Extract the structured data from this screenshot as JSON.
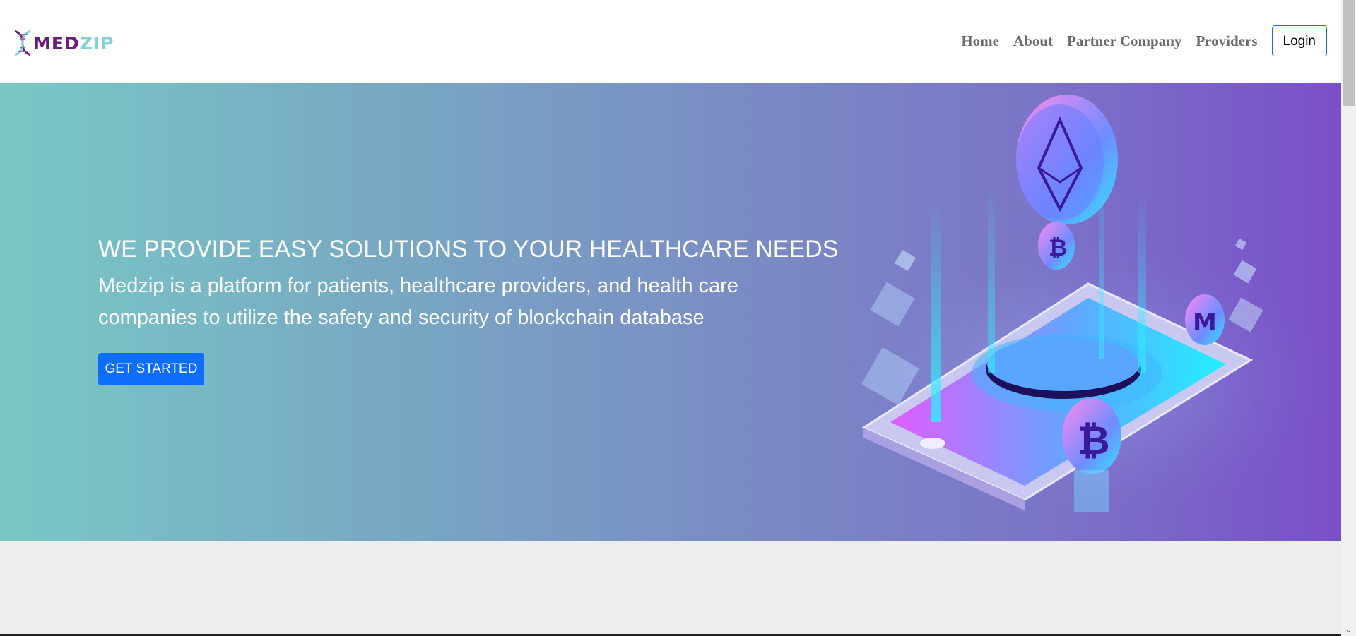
{
  "brand": {
    "logo_text_part1": "MED",
    "logo_text_part2": "ZIP",
    "icon": "dna-icon"
  },
  "nav": {
    "items": [
      {
        "label": "Home"
      },
      {
        "label": "About"
      },
      {
        "label": "Partner Company"
      },
      {
        "label": "Providers"
      }
    ],
    "login_label": "Login"
  },
  "hero": {
    "title": "WE PROVIDE EASY SOLUTIONS TO YOUR HEALTHCARE NEEDS",
    "description": "Medzip is a platform for patients, healthcare providers, and health care companies to utilize the safety and security of blockchain database",
    "cta_label": "GET STARTED"
  },
  "colors": {
    "brand_purple": "#6d1a7e",
    "brand_teal": "#7fd2d6",
    "primary": "#0d6efd",
    "hero_gradient_start": "#79c8c6",
    "hero_gradient_end": "#7a4fc9"
  }
}
